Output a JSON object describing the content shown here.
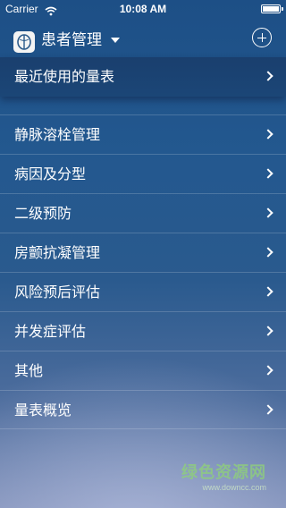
{
  "status_bar": {
    "carrier": "Carrier",
    "time": "10:08 AM"
  },
  "navbar": {
    "title": "患者管理"
  },
  "recent": {
    "label": "最近使用的量表"
  },
  "menu": {
    "items": [
      {
        "label": "静脉溶栓管理"
      },
      {
        "label": "病因及分型"
      },
      {
        "label": "二级预防"
      },
      {
        "label": "房颤抗凝管理"
      },
      {
        "label": "风险预后评估"
      },
      {
        "label": "并发症评估"
      },
      {
        "label": "其他"
      },
      {
        "label": "量表概览"
      }
    ]
  },
  "watermark": {
    "main": "绿色资源网",
    "sub": "www.downcc.com"
  }
}
